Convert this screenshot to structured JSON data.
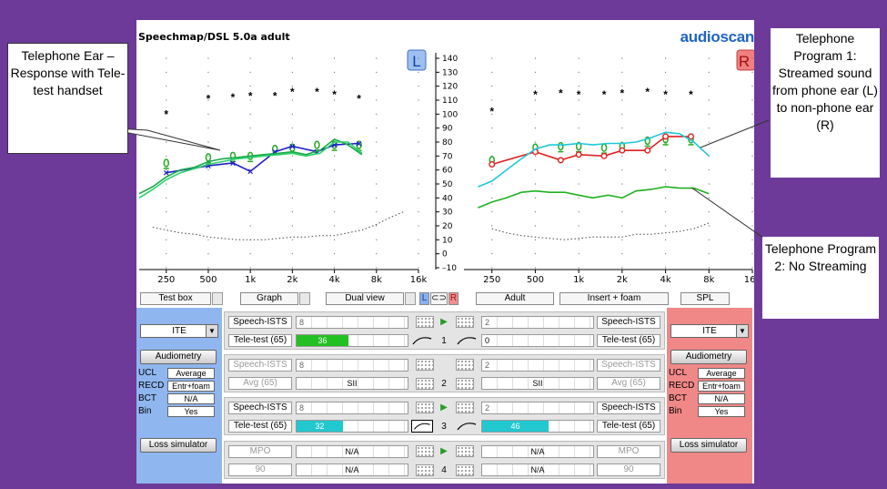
{
  "app": {
    "title": "Speechmap/DSL 5.0a adult",
    "logo": "audioscan"
  },
  "ear_badges": {
    "left": "L",
    "right": "R"
  },
  "chart_data": [
    {
      "type": "line",
      "title": "",
      "xlabel": "",
      "ylabel": "",
      "side": "left",
      "x_ticks": [
        "250",
        "500",
        "1k",
        "2k",
        "4k",
        "8k",
        "16k"
      ],
      "x_values": [
        250,
        500,
        1000,
        2000,
        4000,
        8000,
        16000
      ],
      "xscale": "log",
      "ylim": [
        -10,
        140
      ],
      "y_ticks": [
        140,
        130,
        120,
        110,
        100,
        90,
        80,
        70,
        60,
        50,
        40,
        30,
        20,
        10,
        0,
        -10
      ],
      "series": [
        {
          "kind": "ucl",
          "marker": "*",
          "x": [
            250,
            500,
            750,
            1000,
            1500,
            2000,
            3000,
            4000,
            6000
          ],
          "y": [
            100,
            111,
            112,
            113,
            113,
            116,
            116,
            114,
            111
          ]
        },
        {
          "kind": "targets",
          "marker": "+",
          "x": [
            250,
            500,
            750,
            1000,
            1500,
            2000,
            3000,
            4000,
            6000
          ],
          "y": [
            65,
            69,
            70,
            70,
            75,
            76,
            78,
            78,
            78
          ]
        },
        {
          "kind": "tele-test",
          "color": "#2020c8",
          "x": [
            250,
            500,
            750,
            1000,
            1500,
            2000,
            3000,
            4000,
            6000
          ],
          "y": [
            58,
            63,
            65,
            59,
            73,
            77,
            73,
            78,
            79
          ]
        },
        {
          "kind": "ltass-1",
          "color": "#1aa84a",
          "x": [
            160,
            200,
            250,
            315,
            400,
            500,
            630,
            800,
            1000,
            1250,
            1600,
            2000,
            2500,
            3150,
            4000,
            5000,
            6300
          ],
          "y": [
            43,
            48,
            55,
            60,
            62,
            66,
            68,
            69,
            70,
            71,
            72,
            73,
            71,
            74,
            82,
            78,
            71
          ]
        },
        {
          "kind": "ltass-2",
          "color": "#2ad06a",
          "x": [
            160,
            200,
            250,
            315,
            400,
            500,
            630,
            800,
            1000,
            1250,
            1600,
            2000,
            2500,
            3150,
            4000,
            5000,
            6300
          ],
          "y": [
            40,
            46,
            53,
            58,
            61,
            64,
            66,
            68,
            69,
            70,
            71,
            72,
            70,
            72,
            80,
            80,
            72
          ]
        },
        {
          "kind": "threshold",
          "color": "#444",
          "x": [
            200,
            250,
            315,
            400,
            500,
            630,
            800,
            1000,
            1250,
            1600,
            2000,
            2500,
            3150,
            4000,
            5000,
            6300,
            8000,
            10000,
            12500
          ],
          "y": [
            19,
            17,
            15,
            14,
            12,
            11,
            10,
            10,
            10,
            11,
            12,
            12,
            13,
            13,
            15,
            17,
            21,
            26,
            30
          ]
        }
      ]
    },
    {
      "type": "line",
      "title": "",
      "xlabel": "",
      "ylabel": "",
      "side": "right",
      "x_ticks": [
        "250",
        "500",
        "1k",
        "2k",
        "4k",
        "8k",
        "16k"
      ],
      "x_values": [
        250,
        500,
        1000,
        2000,
        4000,
        8000,
        16000
      ],
      "xscale": "log",
      "ylim": [
        -10,
        140
      ],
      "series": [
        {
          "kind": "ucl",
          "marker": "*",
          "x": [
            250,
            500,
            750,
            1000,
            1500,
            2000,
            3000,
            4000,
            6000
          ],
          "y": [
            102,
            114,
            115,
            114,
            114,
            115,
            116,
            114,
            114
          ]
        },
        {
          "kind": "targets",
          "marker": "+",
          "x": [
            250,
            500,
            750,
            1000,
            1500,
            2000,
            3000,
            4000,
            6000
          ],
          "y": [
            67,
            76,
            77,
            77,
            76,
            77,
            81,
            82,
            82
          ]
        },
        {
          "kind": "program-1",
          "color": "#e02020",
          "x": [
            250,
            500,
            750,
            1000,
            1500,
            2000,
            3000,
            4000,
            6000
          ],
          "y": [
            64,
            73,
            67,
            71,
            70,
            74,
            74,
            84,
            84
          ]
        },
        {
          "kind": "program-1-cyan",
          "color": "#1ec8d8",
          "x": [
            200,
            250,
            315,
            400,
            500,
            630,
            800,
            1000,
            1250,
            1600,
            2000,
            2500,
            3150,
            4000,
            5000,
            6300,
            8000
          ],
          "y": [
            48,
            52,
            60,
            68,
            75,
            78,
            78,
            79,
            78,
            79,
            79,
            80,
            83,
            87,
            86,
            80,
            70
          ]
        },
        {
          "kind": "program-2",
          "color": "#20b020",
          "x": [
            200,
            250,
            315,
            400,
            500,
            630,
            800,
            1000,
            1250,
            1600,
            2000,
            2500,
            3150,
            4000,
            5000,
            6300,
            8000
          ],
          "y": [
            33,
            37,
            40,
            44,
            45,
            44,
            44,
            42,
            40,
            42,
            40,
            45,
            46,
            48,
            47,
            47,
            43
          ]
        },
        {
          "kind": "threshold",
          "color": "#444",
          "x": [
            250,
            315,
            400,
            500,
            630,
            800,
            1000,
            1250,
            1600,
            2000,
            2500,
            3150,
            4000,
            5000,
            6300,
            8000
          ],
          "y": [
            18,
            15,
            13,
            12,
            11,
            10,
            11,
            12,
            12,
            12,
            14,
            14,
            15,
            16,
            18,
            22
          ]
        }
      ]
    }
  ],
  "toolbar": {
    "test_box": "Test box",
    "graph": "Graph",
    "dual_view": "Dual view",
    "l": "L",
    "link": "⊂⊃",
    "r": "R",
    "adult": "Adult",
    "insert_foam": "Insert + foam",
    "spl": "SPL"
  },
  "left_panel": {
    "device": "ITE",
    "audiometry": "Audiometry",
    "rows": [
      [
        "UCL",
        "Average"
      ],
      [
        "RECD",
        "Entr+foam"
      ],
      [
        "BCT",
        "N/A"
      ],
      [
        "Bin",
        "Yes"
      ]
    ],
    "loss_sim": "Loss simulator"
  },
  "right_panel": {
    "device": "ITE",
    "audiometry": "Audiometry",
    "rows": [
      [
        "UCL",
        "Average"
      ],
      [
        "RECD",
        "Entr+foam"
      ],
      [
        "BCT",
        "N/A"
      ],
      [
        "Bin",
        "Yes"
      ]
    ],
    "loss_sim": "Loss simulator"
  },
  "tests": [
    {
      "num": "1",
      "l_stim": "Speech-ISTS",
      "l_stim_small": "8",
      "r_stim": "Speech-ISTS",
      "r_stim_small": "2",
      "l_level": "Tele-test (65)",
      "r_level": "Tele-test (65)",
      "l_bar": "36",
      "l_bar_color": "#22c022",
      "l_bar_fraction": 0.36,
      "r_bar": "0",
      "r_bar_color": "",
      "r_bar_fraction": 0
    },
    {
      "num": "2",
      "l_stim": "Speech-ISTS",
      "l_stim_small": "8",
      "r_stim": "Speech-ISTS",
      "r_stim_small": "2",
      "l_level": "Avg (65)",
      "r_level": "Avg (65)",
      "l_bar": "SII",
      "r_bar": "SII",
      "dim": true
    },
    {
      "num": "3",
      "l_stim": "Speech-ISTS",
      "l_stim_small": "8",
      "r_stim": "Speech-ISTS",
      "r_stim_small": "2",
      "l_level": "Tele-test (65)",
      "r_level": "Tele-test (65)",
      "l_bar": "32",
      "l_bar_color": "#22c8d0",
      "l_bar_fraction": 0.32,
      "r_bar": "46",
      "r_bar_color": "#22c8d0",
      "r_bar_fraction": 0.46
    },
    {
      "num": "4",
      "l_stim": "MPO",
      "r_stim": "MPO",
      "l_level": "90",
      "r_level": "90",
      "l_bar": "N/A",
      "r_bar": "N/A",
      "l_bar2": "N/A",
      "r_bar2": "N/A",
      "dim": true
    }
  ],
  "callouts": {
    "c1": "Telephone Ear – Response with Tele-test handset",
    "c2": "Telephone Program 1: Streamed sound from phone ear (L) to non-phone ear (R)",
    "c3": "Telephone Program 2: No Streaming"
  }
}
